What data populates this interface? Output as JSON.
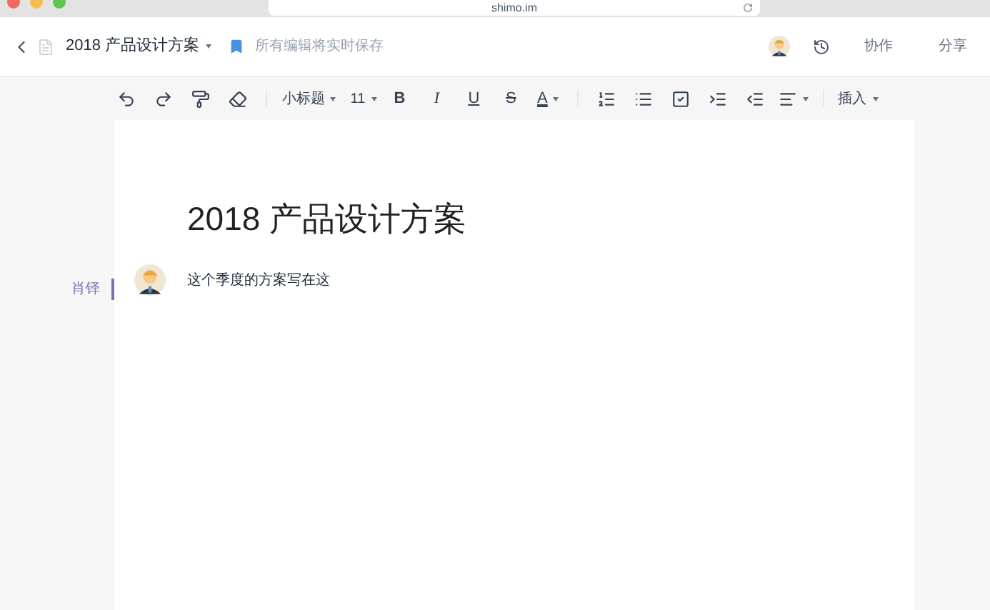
{
  "browser": {
    "url": "shimo.im"
  },
  "header": {
    "title": "2018 产品设计方案",
    "save_status": "所有编辑将实时保存",
    "buttons": [
      "协作",
      "分享"
    ]
  },
  "toolbar": {
    "style": "小标题",
    "font_size": "11",
    "format": [
      {
        "label": "B",
        "kind": "bold"
      },
      {
        "label": "I",
        "kind": "italic"
      },
      {
        "label": "U",
        "kind": "underline"
      },
      {
        "label": "S",
        "kind": "strike"
      },
      {
        "label": "A",
        "kind": "color"
      }
    ],
    "insert": "插入"
  },
  "document": {
    "title": "2018 产品设计方案",
    "paragraphs": [
      {
        "author": "肖铎",
        "text": "这个季度的方案写在这"
      }
    ]
  }
}
